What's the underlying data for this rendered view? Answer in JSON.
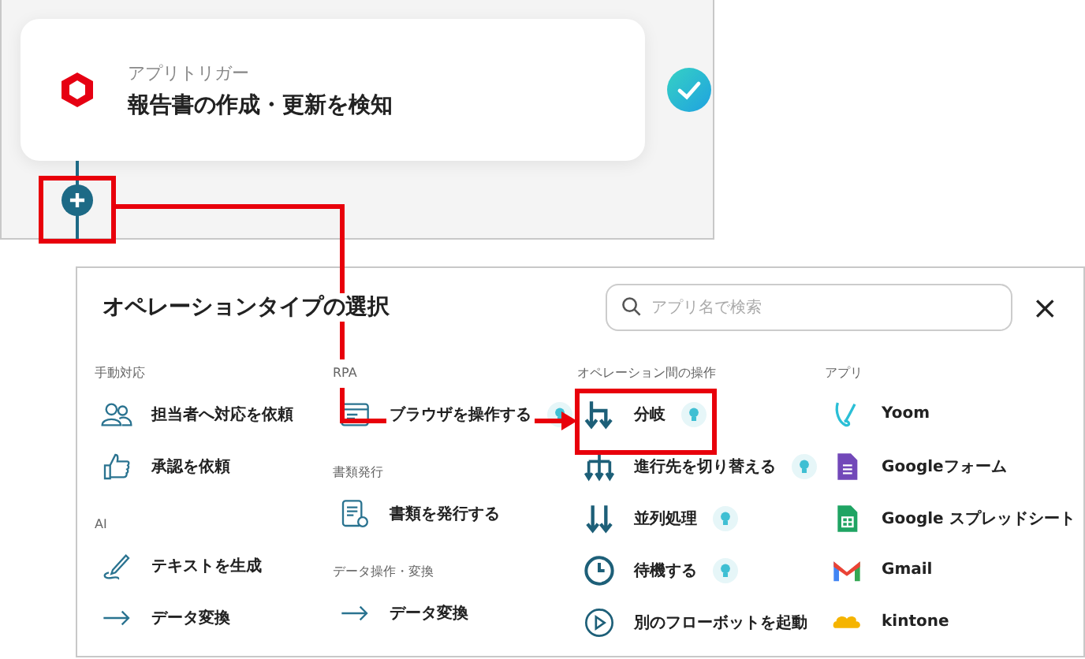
{
  "trigger": {
    "label": "アプリトリガー",
    "title": "報告書の作成・更新を検知",
    "done": true
  },
  "modal": {
    "title": "オペレーションタイプの選択",
    "search": {
      "placeholder": "アプリ名で検索"
    },
    "close": "×",
    "columns": [
      {
        "sections": [
          {
            "heading": "手動対応",
            "items": [
              {
                "label": "担当者へ対応を依頼",
                "hint_badge": false
              },
              {
                "label": "承認を依頼",
                "hint_badge": false
              }
            ]
          },
          {
            "heading": "AI",
            "items": [
              {
                "label": "テキストを生成",
                "hint_badge": false
              },
              {
                "label": "データ変換",
                "hint_badge": false
              }
            ]
          }
        ]
      },
      {
        "sections": [
          {
            "heading": "RPA",
            "items": [
              {
                "label": "ブラウザを操作する",
                "hint_badge": true
              }
            ]
          },
          {
            "heading": "書類発行",
            "items": [
              {
                "label": "書類を発行する",
                "hint_badge": false
              }
            ]
          },
          {
            "heading": "データ操作・変換",
            "items": [
              {
                "label": "データ変換",
                "hint_badge": false
              }
            ]
          }
        ]
      },
      {
        "sections": [
          {
            "heading": "オペレーション間の操作",
            "items": [
              {
                "label": "分岐",
                "hint_badge": true
              },
              {
                "label": "進行先を切り替える",
                "hint_badge": true
              },
              {
                "label": "並列処理",
                "hint_badge": true
              },
              {
                "label": "待機する",
                "hint_badge": true
              },
              {
                "label": "別のフローボットを起動",
                "hint_badge": false
              }
            ]
          }
        ]
      },
      {
        "sections": [
          {
            "heading": "アプリ",
            "items": [
              {
                "label": "Yoom",
                "hint_badge": false
              },
              {
                "label": "Googleフォーム",
                "hint_badge": false
              },
              {
                "label": "Google スプレッドシート",
                "hint_badge": false
              },
              {
                "label": "Gmail",
                "hint_badge": false
              },
              {
                "label": "kintone",
                "hint_badge": false
              }
            ]
          }
        ]
      }
    ]
  }
}
